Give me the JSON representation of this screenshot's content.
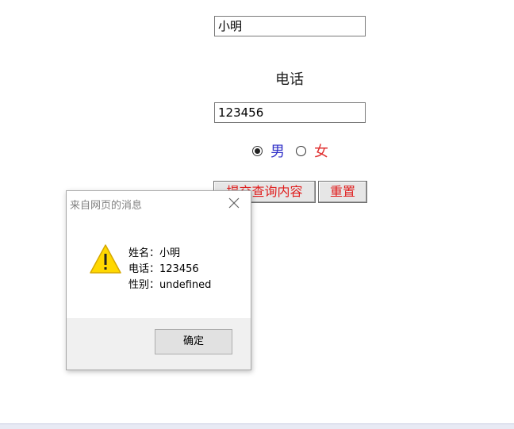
{
  "form": {
    "name_value": "小明",
    "phone_label": "电话",
    "phone_value": "123456",
    "gender": {
      "options": [
        {
          "label": "男",
          "checked": true,
          "color": "#3030c8"
        },
        {
          "label": "女",
          "checked": false,
          "color": "#e03030"
        }
      ]
    },
    "submit_label": "提交查询内容",
    "reset_label": "重置"
  },
  "dialog": {
    "title": "来自网页的消息",
    "icon": "warning-icon",
    "lines": [
      "姓名：小明",
      "电话：123456",
      "性别：undefined"
    ],
    "ok_label": "确定"
  }
}
